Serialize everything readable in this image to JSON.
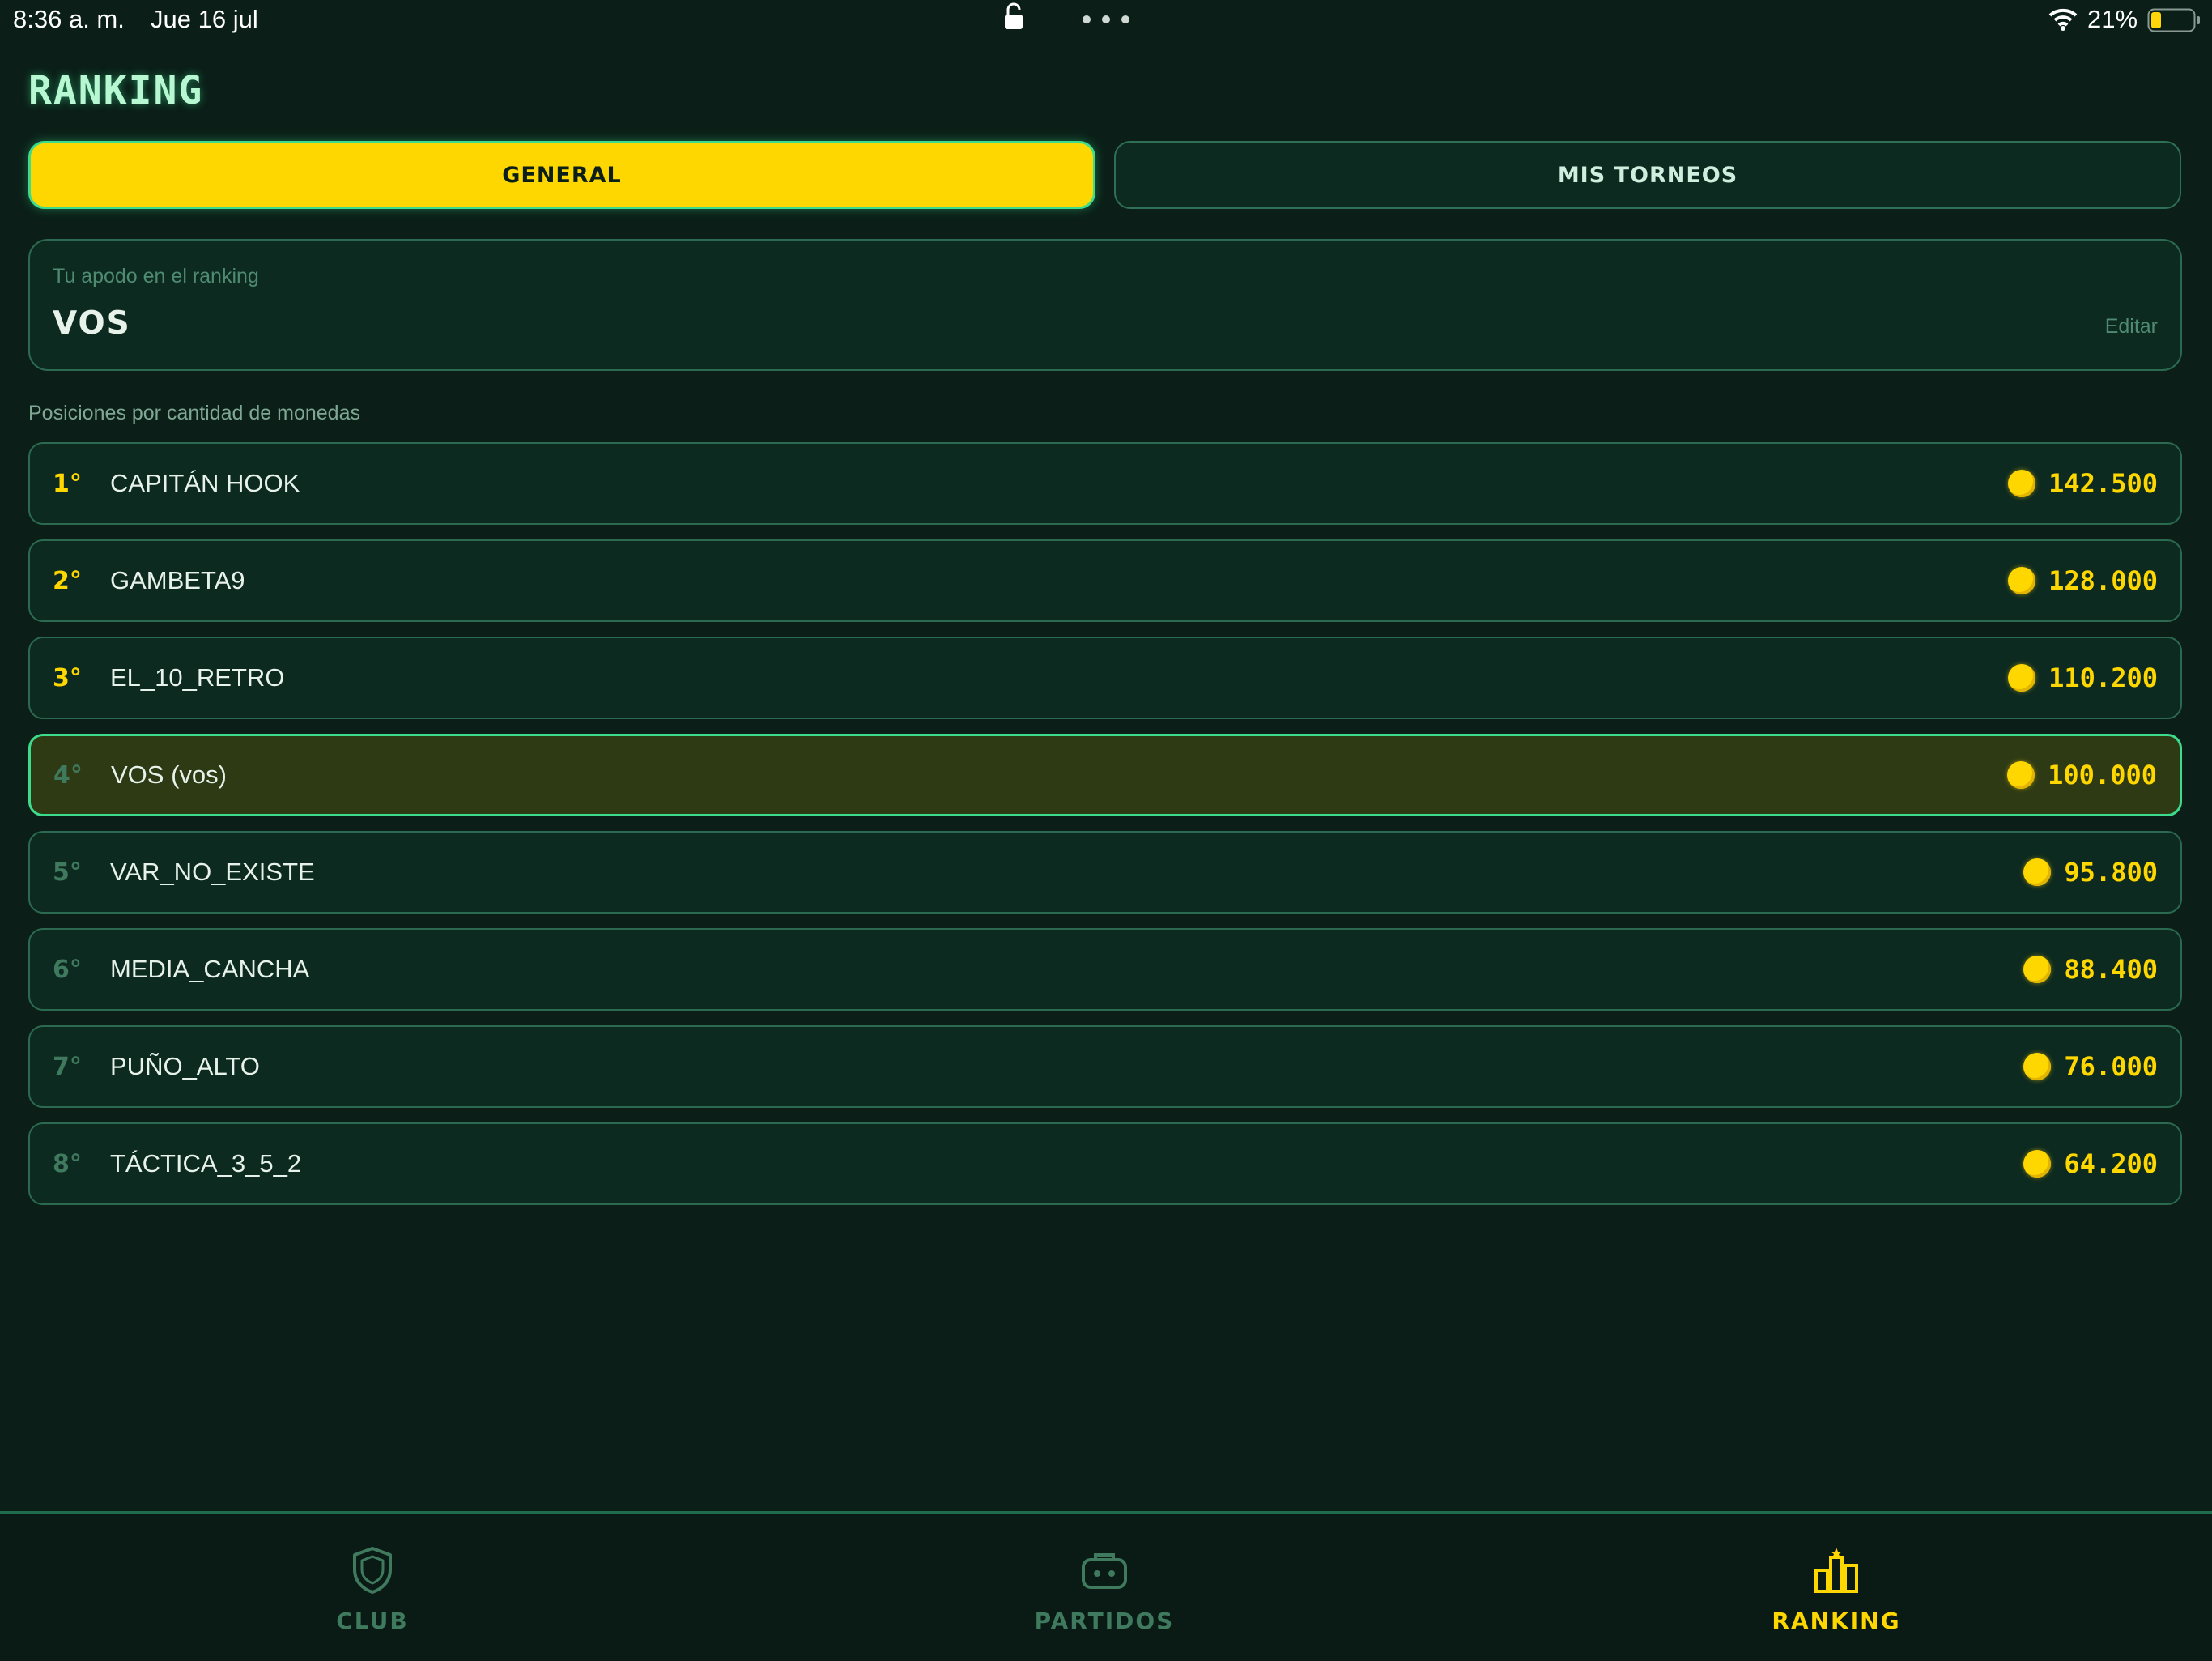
{
  "status_bar": {
    "time": "8:36 a. m.",
    "date": "Jue 16 jul",
    "battery": "21%"
  },
  "page": {
    "title": "RANKING"
  },
  "tabs": [
    {
      "label": "GENERAL",
      "active": true
    },
    {
      "label": "MIS TORNEOS",
      "active": false
    }
  ],
  "nickname": {
    "label": "Tu apodo en el ranking",
    "value": "VOS",
    "edit_label": "Editar"
  },
  "section_label": "Posiciones por cantidad de monedas",
  "ranking": [
    {
      "position": "1°",
      "name": "CAPITÁN HOOK",
      "coins": "142.500",
      "highlight": false
    },
    {
      "position": "2°",
      "name": "GAMBETA9",
      "coins": "128.000",
      "highlight": false
    },
    {
      "position": "3°",
      "name": "EL_10_RETRO",
      "coins": "110.200",
      "highlight": false
    },
    {
      "position": "4°",
      "name": "VOS (vos)",
      "coins": "100.000",
      "highlight": true
    },
    {
      "position": "5°",
      "name": "VAR_NO_EXISTE",
      "coins": "95.800",
      "highlight": false
    },
    {
      "position": "6°",
      "name": "MEDIA_CANCHA",
      "coins": "88.400",
      "highlight": false
    },
    {
      "position": "7°",
      "name": "PUÑO_ALTO",
      "coins": "76.000",
      "highlight": false
    },
    {
      "position": "8°",
      "name": "TÁCTICA_3_5_2",
      "coins": "64.200",
      "highlight": false
    }
  ],
  "bottom_nav": [
    {
      "label": "CLUB",
      "icon": "shield-icon",
      "active": false
    },
    {
      "label": "PARTIDOS",
      "icon": "gamepad-icon",
      "active": false
    },
    {
      "label": "RANKING",
      "icon": "ranking-icon",
      "active": true
    }
  ],
  "colors": {
    "background": "#0b1f18",
    "accent": "#ffd700",
    "highlight_border": "#3ddc8c",
    "title_glow": "#b7f7d2"
  }
}
